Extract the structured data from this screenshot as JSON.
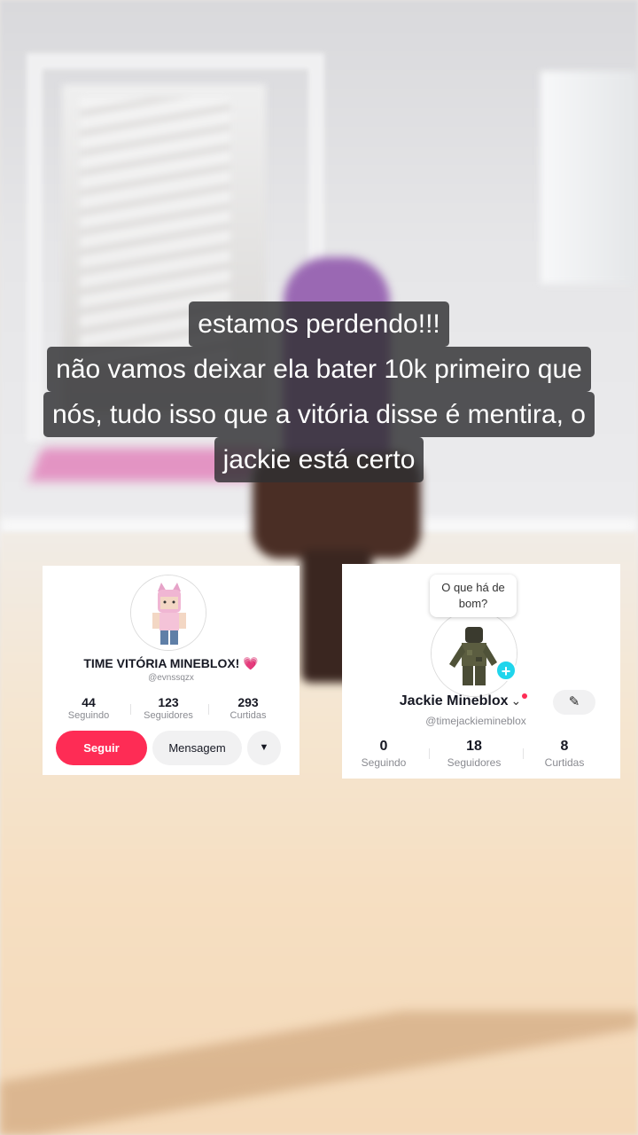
{
  "caption": {
    "lines": [
      "estamos perdendo!!!",
      "não vamos deixar ela bater 10k primeiro que",
      "nós, tudo isso que a vitória disse é mentira, o",
      "jackie está certo"
    ]
  },
  "profile_left": {
    "name": "TIME VITÓRIA MINEBLOX! 💗",
    "handle": "@evnssqzx",
    "stats": [
      {
        "value": "44",
        "label": "Seguindo"
      },
      {
        "value": "123",
        "label": "Seguidores"
      },
      {
        "value": "293",
        "label": "Curtidas"
      }
    ],
    "buttons": {
      "follow": "Seguir",
      "message": "Mensagem",
      "more": "▼"
    },
    "accent_color": "#fe2c55"
  },
  "profile_right": {
    "bubble": "O que há de bom?",
    "name": "Jackie Mineblox",
    "handle": "@timejackiemineblox",
    "stats": [
      {
        "value": "0",
        "label": "Seguindo"
      },
      {
        "value": "18",
        "label": "Seguidores"
      },
      {
        "value": "8",
        "label": "Curtidas"
      }
    ],
    "icons": {
      "add": "plus-icon",
      "edit": "pencil-icon",
      "chevron": "chevron-down-icon"
    },
    "plus_color": "#20d5ec"
  }
}
